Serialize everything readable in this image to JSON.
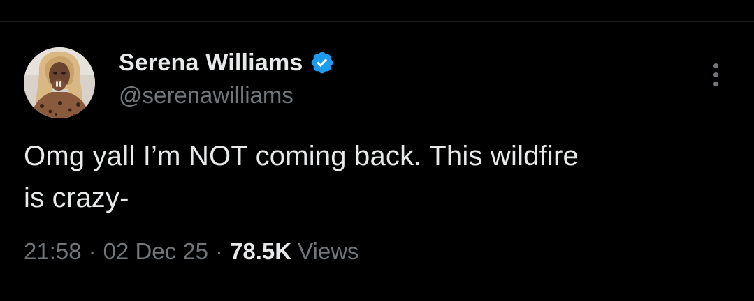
{
  "tweet": {
    "author": {
      "display_name": "Serena Williams",
      "handle": "@serenawilliams",
      "verified": true,
      "avatar_icon": "profile-photo"
    },
    "text_line_1": "Omg yall I’m NOT coming back. This wildfire",
    "text_line_2": "is crazy-",
    "meta": {
      "time": "21:58",
      "separator": "·",
      "date": "02 Dec 25",
      "views_count": "78.5K",
      "views_label": "Views"
    },
    "more_icon": "more-vertical-icon"
  },
  "colors": {
    "background": "#000000",
    "primary_text": "#e7e9ea",
    "secondary_text": "#71767b",
    "verified_blue": "#1d9bf0"
  }
}
